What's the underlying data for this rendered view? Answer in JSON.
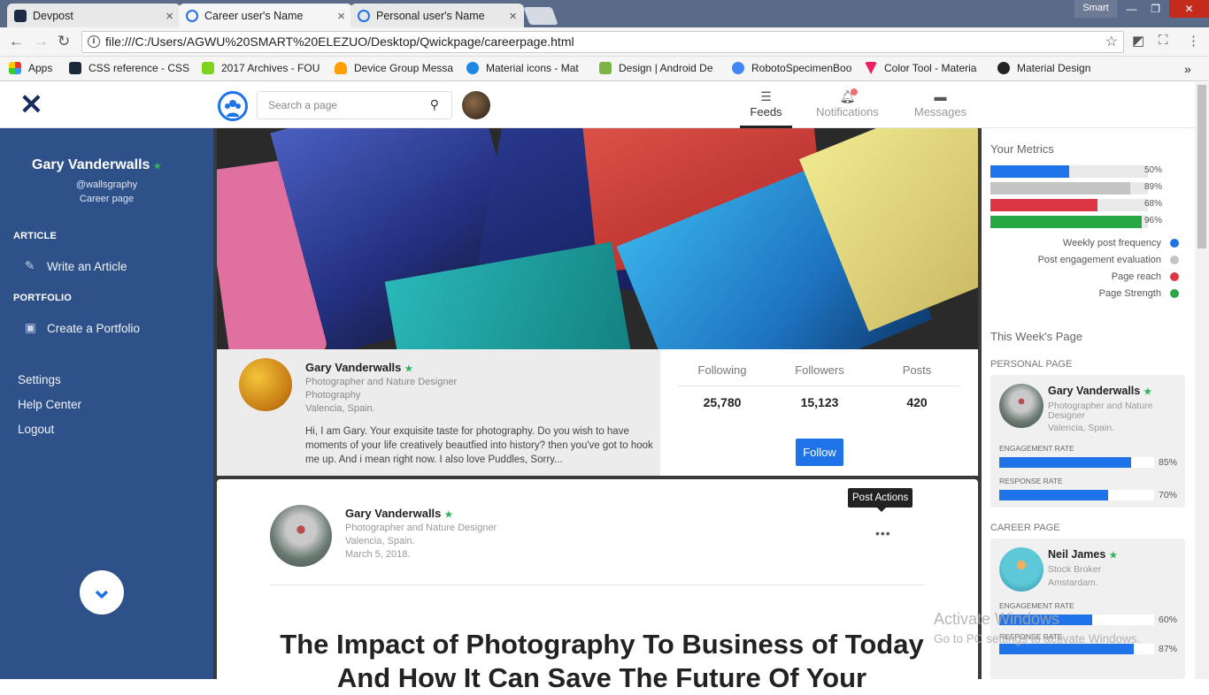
{
  "browser": {
    "tabs": [
      {
        "title": "Devpost"
      },
      {
        "title": "Career user's Name"
      },
      {
        "title": "Personal user's Name"
      }
    ],
    "user": "Smart",
    "url": "file:///C:/Users/AGWU%20SMART%20ELEZUO/Desktop/Qwickpage/careerpage.html",
    "bookmarks": [
      "Apps",
      "CSS reference - CSS",
      "2017 Archives - FOU",
      "Device Group Messa",
      "Material icons - Mat",
      "Design | Android De",
      "RobotoSpecimenBoo",
      "Color Tool - Materia",
      "Material Design"
    ]
  },
  "topbar": {
    "search_placeholder": "Search a page",
    "nav": [
      {
        "label": "Feeds"
      },
      {
        "label": "Notifications"
      },
      {
        "label": "Messages"
      }
    ]
  },
  "sidebar": {
    "name": "Gary Vanderwalls",
    "handle": "@wallsgraphy",
    "page_type": "Career page",
    "sections": [
      {
        "heading": "ARTICLE",
        "item": "Write an Article"
      },
      {
        "heading": "PORTFOLIO",
        "item": "Create a Portfolio"
      }
    ],
    "links": [
      "Settings",
      "Help Center",
      "Logout"
    ]
  },
  "profile": {
    "name": "Gary Vanderwalls",
    "role": "Photographer and Nature Designer",
    "field": "Photography",
    "location": "Valencia, Spain.",
    "bio": "Hi, I am Gary. Your exquisite taste for photography. Do you wish to have moments of your life creatively beautfied into history? then you've got to hook me up. And i mean right now. I also love Puddles, Sorry...",
    "stats": [
      {
        "label": "Following",
        "value": "25,780"
      },
      {
        "label": "Followers",
        "value": "15,123"
      },
      {
        "label": "Posts",
        "value": "420"
      }
    ],
    "follow_label": "Follow"
  },
  "post": {
    "author": "Gary Vanderwalls",
    "role": "Photographer and Nature Designer",
    "location": "Valencia, Spain.",
    "date": "March 5, 2018.",
    "actions_tooltip": "Post Actions",
    "title": "The Impact of Photography To Business of Today And How It Can Save The Future Of Your"
  },
  "metrics": {
    "heading": "Your Metrics",
    "bars": [
      {
        "name": "Weekly post frequency",
        "value": 50,
        "label": "50%",
        "color": "#1e73e8"
      },
      {
        "name": "Post engagement evaluation",
        "value": 89,
        "label": "89%",
        "color": "#c4c4c4"
      },
      {
        "name": "Page reach",
        "value": 68,
        "label": "68%",
        "color": "#dc3545"
      },
      {
        "name": "Page Strength",
        "value": 96,
        "label": "96%",
        "color": "#28a745"
      }
    ]
  },
  "week": {
    "heading": "This Week's Page",
    "pages": [
      {
        "caption": "PERSONAL PAGE",
        "name": "Gary Vanderwalls",
        "role": "Photographer and Nature Designer",
        "location": "Valencia, Spain.",
        "engagement_label": "ENGAGEMENT RATE",
        "engagement": 85,
        "engagement_text": "85%",
        "response_label": "RESPONSE RATE",
        "response": 70,
        "response_text": "70%"
      },
      {
        "caption": "CAREER PAGE",
        "name": "Neil James",
        "role": "Stock Broker",
        "location": "Amstardam.",
        "engagement_label": "ENGAGEMENT RATE",
        "engagement": 60,
        "engagement_text": "60%",
        "response_label": "RESPONSE RATE",
        "response": 87,
        "response_text": "87%"
      }
    ]
  },
  "watermark": {
    "line1": "Activate Windows",
    "line2": "Go to PC settings to activate Windows."
  }
}
